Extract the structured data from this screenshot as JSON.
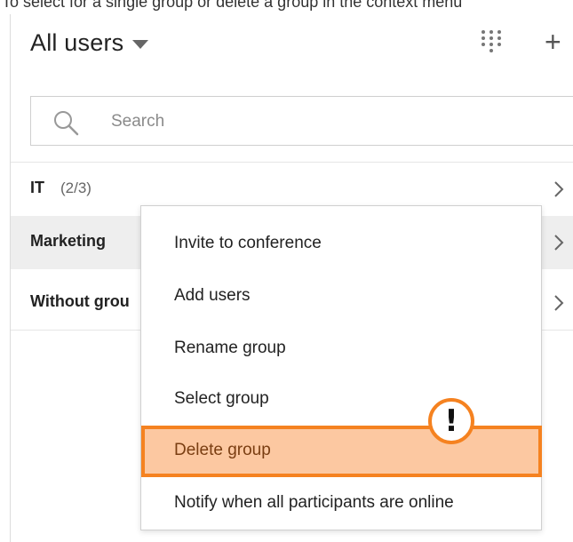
{
  "caption": "To select for a single group or delete a group in the context menu",
  "header": {
    "title": "All users",
    "dropdown_icon": "caret-down-icon",
    "dialpad_icon": "dialpad-icon",
    "add_icon": "plus-icon"
  },
  "search": {
    "placeholder": "Search",
    "value": ""
  },
  "groups": [
    {
      "name": "IT",
      "count": "(2/3)"
    },
    {
      "name": "Marketing",
      "count": "("
    },
    {
      "name": "Without grou",
      "count": ""
    }
  ],
  "context_menu": {
    "items": [
      {
        "label": "Invite to conference"
      },
      {
        "label": "Add users"
      },
      {
        "label": "Rename group"
      },
      {
        "label": "Select group"
      },
      {
        "label": "Delete group"
      },
      {
        "label": "Notify when all participants are online"
      }
    ],
    "highlighted_index": 4
  },
  "callout": {
    "symbol": "!",
    "color": "#f58220"
  },
  "colors": {
    "accent": "#f58220",
    "highlight_fill": "#fcc8a1",
    "active_row": "#eeeeee"
  }
}
